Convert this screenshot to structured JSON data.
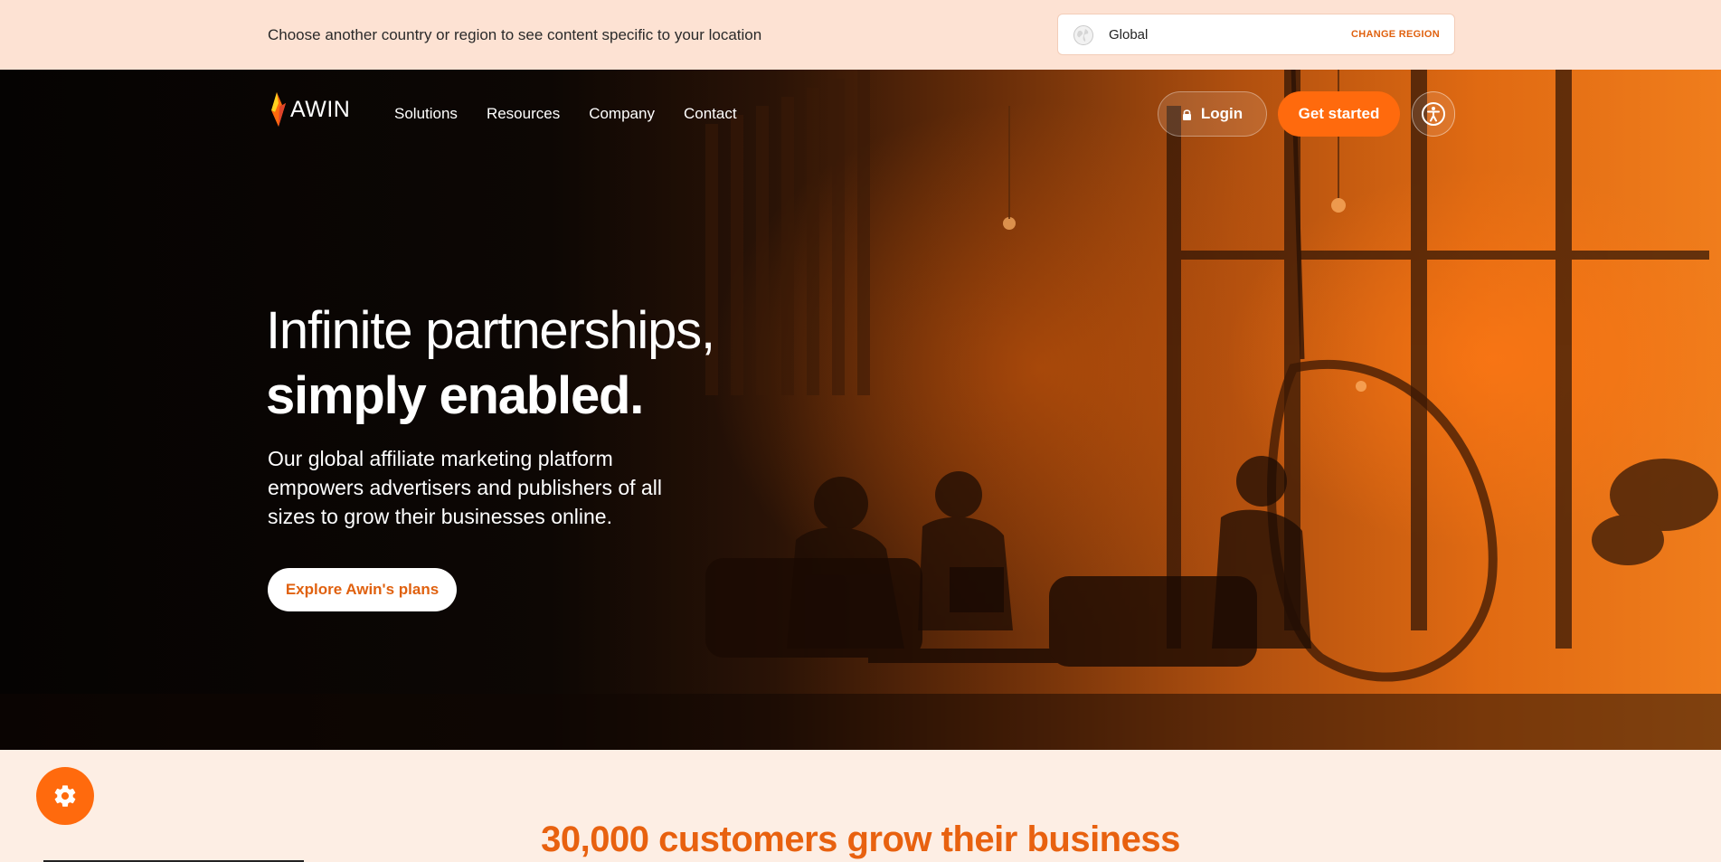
{
  "region_banner": {
    "text": "Choose another country or region to see content specific to your location",
    "selected_region": "Global",
    "change_label": "CHANGE REGION",
    "globe_icon": "globe-icon"
  },
  "nav": {
    "logo_text": "AWIN",
    "items": [
      {
        "label": "Solutions"
      },
      {
        "label": "Resources"
      },
      {
        "label": "Company"
      },
      {
        "label": "Contact"
      }
    ],
    "login_label": "Login",
    "login_icon": "lock-icon",
    "get_started_label": "Get started",
    "accessibility_icon": "accessibility-icon"
  },
  "hero": {
    "headline_line1": "Infinite partnerships,",
    "headline_line2": "simply enabled.",
    "description": "Our global affiliate marketing platform empowers advertisers and publishers of all sizes to grow their businesses online.",
    "cta_label": "Explore Awin's plans"
  },
  "settings_fab": {
    "icon": "gear-icon"
  },
  "section": {
    "heading": "30,000 customers grow their business"
  },
  "colors": {
    "accent": "#ff6a0d",
    "accent_text": "#e0610f",
    "banner_bg": "#fde2d3",
    "page_bg": "#fdeee4"
  }
}
